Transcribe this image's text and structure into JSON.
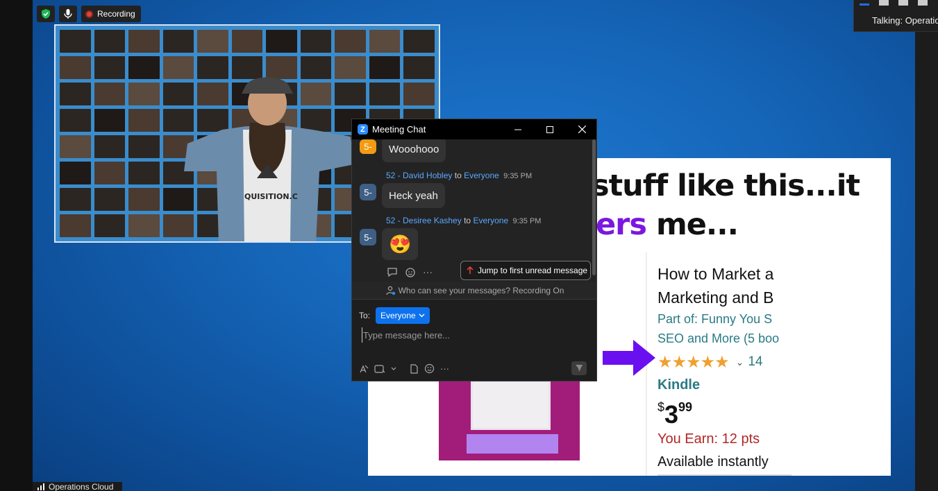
{
  "status_bar": {
    "shield_icon": "shield-check-icon",
    "mic_icon": "microphone-icon",
    "recording_label": "Recording"
  },
  "talking_indicator": {
    "text": "Talking: Operatio"
  },
  "speaker_video": {
    "shirt_text": "QUISITION.C"
  },
  "slide": {
    "headline_line1": "stuff like this...it",
    "headline_line2_accent": "ers",
    "headline_line2_rest": " me...",
    "product": {
      "title_line1": "How to Market a",
      "title_line2": "Marketing and B",
      "series_line1": "Part of: Funny You S",
      "series_line2": "SEO and More (5 boo",
      "rating_stars": "★★★★★",
      "rating_count": "14",
      "format": "Kindle",
      "price_currency": "$",
      "price_whole": "3",
      "price_fraction": "99",
      "earn": "You Earn: 12 pts",
      "availability": "Available instantly"
    },
    "colors": {
      "accent_purple": "#7b17e0",
      "arrow": "#6a10f0"
    }
  },
  "bottom_label": {
    "text": "Operations Cloud"
  },
  "chat": {
    "title": "Meeting Chat",
    "messages": [
      {
        "avatar": "5-",
        "avatar_color": "#f29b13",
        "text": "Wooohooo"
      },
      {
        "sender": "52 - David Hobley",
        "to_word": "to",
        "recipient": "Everyone",
        "time": "9:35 PM",
        "avatar": "5-",
        "avatar_color": "#3f5f85",
        "text": "Heck yeah"
      },
      {
        "sender": "52 - Desiree Kashey",
        "to_word": "to",
        "recipient": "Everyone",
        "time": "9:35 PM",
        "avatar": "5-",
        "avatar_color": "#3f5f85",
        "text": "😍"
      }
    ],
    "jump_button": "Jump to first unread message",
    "visibility_note": "Who can see your messages? Recording On",
    "to_label": "To:",
    "to_value": "Everyone",
    "input_placeholder": "Type message here..."
  }
}
